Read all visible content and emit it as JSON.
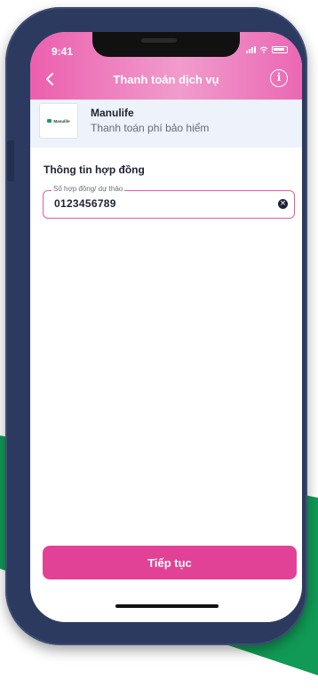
{
  "status_bar": {
    "time": "9:41"
  },
  "nav": {
    "title": "Thanh toán dịch vụ",
    "info_icon": "info-icon",
    "back_icon": "chevron-left-icon"
  },
  "provider": {
    "logo_text": "Manulife",
    "name": "Manulife",
    "description": "Thanh toán phí bảo hiểm"
  },
  "form": {
    "section_title": "Thông tin hợp đồng",
    "contract_field": {
      "label": "Số hợp đồng/ dự thảo",
      "value": "0123456789"
    }
  },
  "actions": {
    "continue_label": "Tiếp tục"
  },
  "colors": {
    "accent": "#e24296",
    "header_start": "#ec5fae",
    "brand_green": "#1c9d5c",
    "frame": "#2c3a5f"
  }
}
